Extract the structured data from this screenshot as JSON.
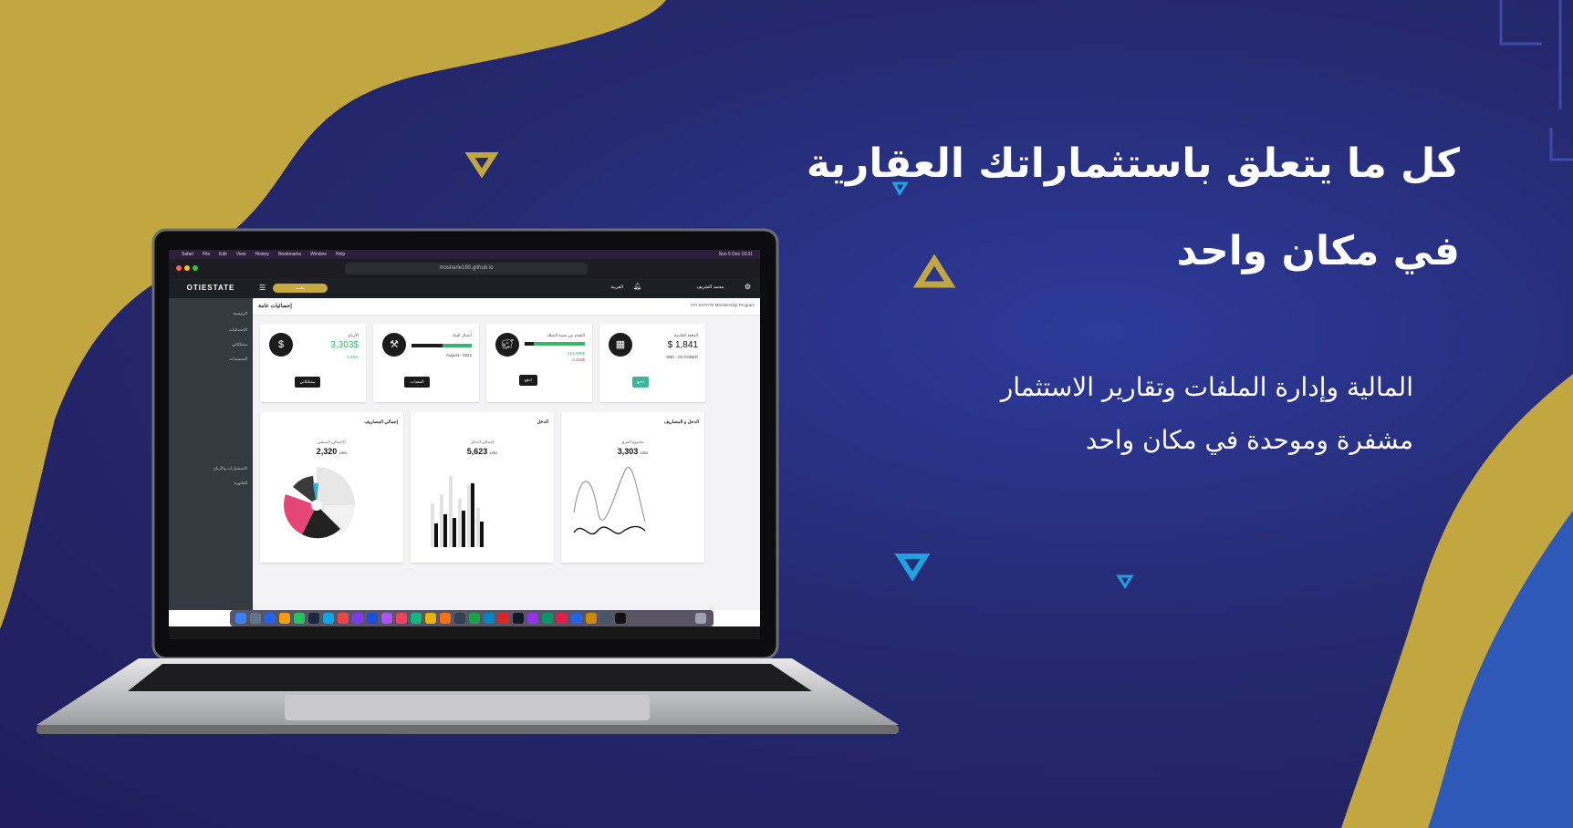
{
  "marketing": {
    "headline_line1": "كل ما يتعلق باستثماراتك العقارية",
    "headline_line2": "في مكان واحد",
    "sub_line1": "المالية وإدارة الملفات وتقارير الاستثمار",
    "sub_line2": "مشفرة وموحدة في مكان واحد"
  },
  "colors": {
    "background": "#25296f",
    "gold": "#c2a63f",
    "triangle_blue": "#1fa3e0",
    "card_green": "#3bb36a"
  },
  "browser": {
    "menu_items": [
      "Safari",
      "File",
      "Edit",
      "View",
      "History",
      "Bookmarks",
      "Window",
      "Help"
    ],
    "clock": "Sun 5 Dec 19:31",
    "url": "mosharie190.github.io"
  },
  "app": {
    "logo": "OTIESTATE",
    "search_label": "بحث",
    "language": "العربية",
    "user_name": "محمد الشريف",
    "page_title": "إحصائيات عامة",
    "breadcrumb": "OTI ESTATE Membership Program",
    "sidebar": [
      {
        "label": "الرئيسية"
      },
      {
        "label": "الإحصائيات"
      },
      {
        "label": "ممتلكاتي"
      },
      {
        "label": "المستندات"
      },
      {
        "label": "الاستثمارات والأرباح"
      },
      {
        "label": "الفاتورة"
      }
    ],
    "cards": [
      {
        "label": "الأرباح",
        "value": "3,303$",
        "note": "5.46%",
        "button": "ممتلكاتي",
        "icon": "dollar-icon"
      },
      {
        "label": "أعمال البناء",
        "value": "",
        "note": "August - 2022",
        "button": "المعدات",
        "icon": "hammer-icon"
      },
      {
        "label": "التقدم من نسبة التملك",
        "value": "124,086$",
        "note": "4,300$",
        "button": "ادفع",
        "icon": "piggy-bank-icon"
      },
      {
        "label": "الدفعة القادمة",
        "value": "$ 1,841",
        "note": "30th - OCTOBER",
        "button": "ادفع",
        "icon": "calendar-icon"
      }
    ],
    "charts": [
      {
        "title": "إجمالي المصاريف",
        "subtitle": "الإجمالي المتبقي",
        "value": "2,320",
        "unit": "USD"
      },
      {
        "title": "الدخل",
        "subtitle": "إجمالي الدخل",
        "value": "5,623",
        "unit": "USD"
      },
      {
        "title": "الدخل و المصاريف",
        "subtitle": "مجموع الفرق",
        "value": "3,303",
        "unit": "USD"
      }
    ]
  }
}
